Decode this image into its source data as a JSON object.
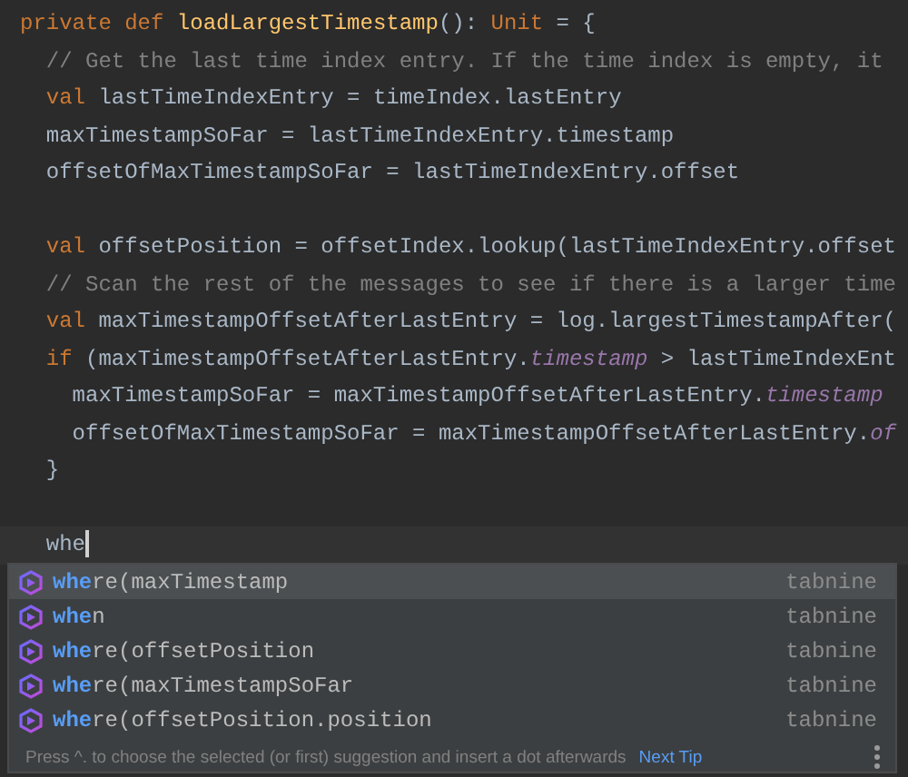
{
  "editor": {
    "lines": [
      {
        "tokens": [
          {
            "kind": "keyword",
            "text": "private def "
          },
          {
            "kind": "function",
            "text": "loadLargestTimestamp"
          },
          {
            "kind": "plain",
            "text": "(): "
          },
          {
            "kind": "keyword",
            "text": "Unit"
          },
          {
            "kind": "plain",
            "text": " = {"
          }
        ]
      },
      {
        "tokens": [
          {
            "kind": "comment",
            "text": "  // Get the last time index entry. If the time index is empty, it"
          }
        ]
      },
      {
        "tokens": [
          {
            "kind": "keyword",
            "text": "  val "
          },
          {
            "kind": "plain",
            "text": "lastTimeIndexEntry = timeIndex.lastEntry"
          }
        ]
      },
      {
        "tokens": [
          {
            "kind": "plain",
            "text": "  maxTimestampSoFar = lastTimeIndexEntry.timestamp"
          }
        ]
      },
      {
        "tokens": [
          {
            "kind": "plain",
            "text": "  offsetOfMaxTimestampSoFar = lastTimeIndexEntry.offset"
          }
        ]
      },
      {
        "kind": "blank"
      },
      {
        "tokens": [
          {
            "kind": "keyword",
            "text": "  val "
          },
          {
            "kind": "plain",
            "text": "offsetPosition = offsetIndex.lookup(lastTimeIndexEntry.offset"
          }
        ]
      },
      {
        "tokens": [
          {
            "kind": "comment",
            "text": "  // Scan the rest of the messages to see if there is a larger time"
          }
        ]
      },
      {
        "tokens": [
          {
            "kind": "keyword",
            "text": "  val "
          },
          {
            "kind": "plain",
            "text": "maxTimestampOffsetAfterLastEntry = log.largestTimestampAfter("
          }
        ]
      },
      {
        "tokens": [
          {
            "kind": "keyword",
            "text": "  if "
          },
          {
            "kind": "plain",
            "text": "(maxTimestampOffsetAfterLastEntry."
          },
          {
            "kind": "field",
            "text": "timestamp"
          },
          {
            "kind": "plain",
            "text": " > lastTimeIndexEnt"
          }
        ]
      },
      {
        "tokens": [
          {
            "kind": "plain",
            "text": "    maxTimestampSoFar = maxTimestampOffsetAfterLastEntry."
          },
          {
            "kind": "field",
            "text": "timestamp"
          }
        ]
      },
      {
        "tokens": [
          {
            "kind": "plain",
            "text": "    offsetOfMaxTimestampSoFar = maxTimestampOffsetAfterLastEntry."
          },
          {
            "kind": "field",
            "text": "of"
          }
        ]
      },
      {
        "tokens": [
          {
            "kind": "plain",
            "text": "  }"
          }
        ]
      },
      {
        "kind": "blank"
      },
      {
        "kind": "current",
        "tokens": [
          {
            "kind": "plain",
            "text": "  whe"
          }
        ]
      }
    ]
  },
  "completion": {
    "items": [
      {
        "match": "whe",
        "rest": "re(maxTimestamp",
        "source": "tabnine",
        "selected": true
      },
      {
        "match": "whe",
        "rest": "n",
        "source": "tabnine",
        "selected": false
      },
      {
        "match": "whe",
        "rest": "re(offsetPosition",
        "source": "tabnine",
        "selected": false
      },
      {
        "match": "whe",
        "rest": "re(maxTimestampSoFar",
        "source": "tabnine",
        "selected": false
      },
      {
        "match": "whe",
        "rest": "re(offsetPosition.position",
        "source": "tabnine",
        "selected": false
      }
    ],
    "tip": "Press ^. to choose the selected (or first) suggestion and insert a dot afterwards",
    "tip_link": "Next Tip"
  }
}
